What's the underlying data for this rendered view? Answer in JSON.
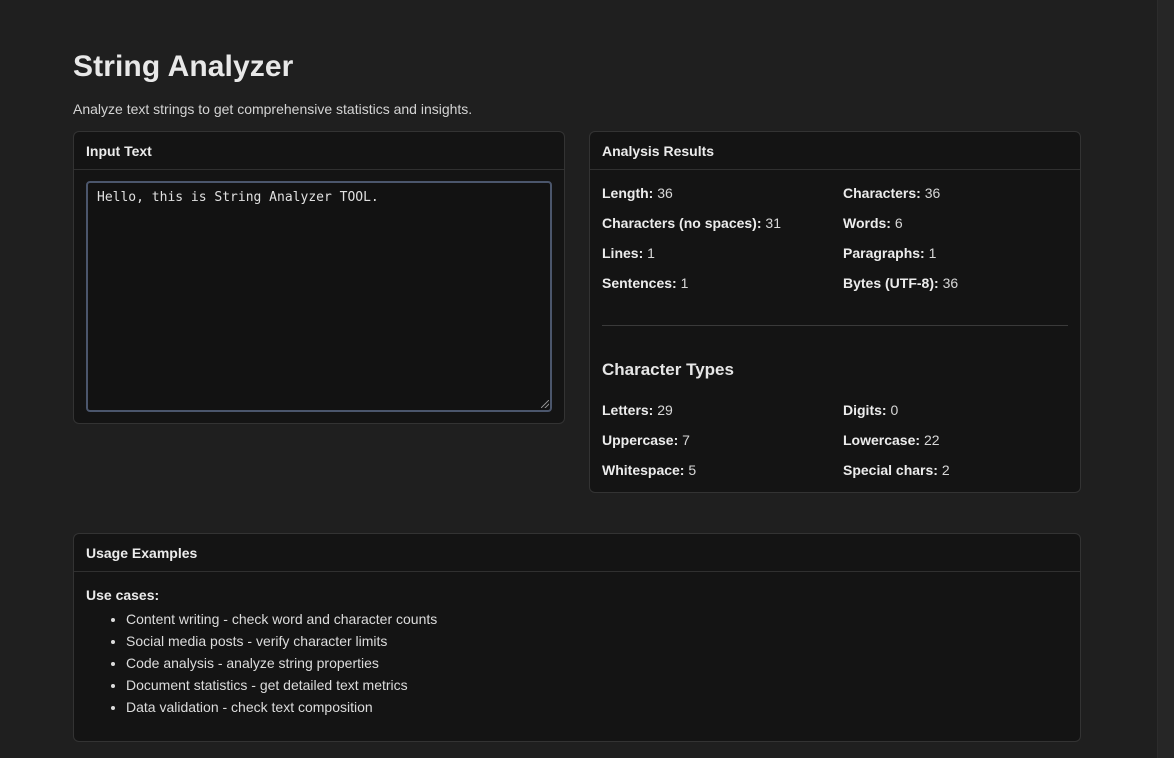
{
  "header": {
    "title": "String Analyzer",
    "subtitle": "Analyze text strings to get comprehensive statistics and insights."
  },
  "input_card": {
    "title": "Input Text",
    "text_value": "Hello, this is String Analyzer TOOL."
  },
  "results_card": {
    "title": "Analysis Results",
    "basic_stats": [
      {
        "label": "Length:",
        "value": "36"
      },
      {
        "label": "Characters:",
        "value": "36"
      },
      {
        "label": "Characters (no spaces):",
        "value": "31"
      },
      {
        "label": "Words:",
        "value": "6"
      },
      {
        "label": "Lines:",
        "value": "1"
      },
      {
        "label": "Paragraphs:",
        "value": "1"
      },
      {
        "label": "Sentences:",
        "value": "1"
      },
      {
        "label": "Bytes (UTF-8):",
        "value": "36"
      }
    ],
    "types_title": "Character Types",
    "type_stats": [
      {
        "label": "Letters:",
        "value": "29"
      },
      {
        "label": "Digits:",
        "value": "0"
      },
      {
        "label": "Uppercase:",
        "value": "7"
      },
      {
        "label": "Lowercase:",
        "value": "22"
      },
      {
        "label": "Whitespace:",
        "value": "5"
      },
      {
        "label": "Special chars:",
        "value": "2"
      }
    ]
  },
  "usage_card": {
    "title": "Usage Examples",
    "use_cases_label": "Use cases:",
    "items": [
      "Content writing - check word and character counts",
      "Social media posts - verify character limits",
      "Code analysis - analyze string properties",
      "Document statistics - get detailed text metrics",
      "Data validation - check text composition"
    ]
  },
  "colors": {
    "background": "#1f1f1f",
    "card_background": "#141414",
    "textarea_focus_border": "#4b566c"
  }
}
